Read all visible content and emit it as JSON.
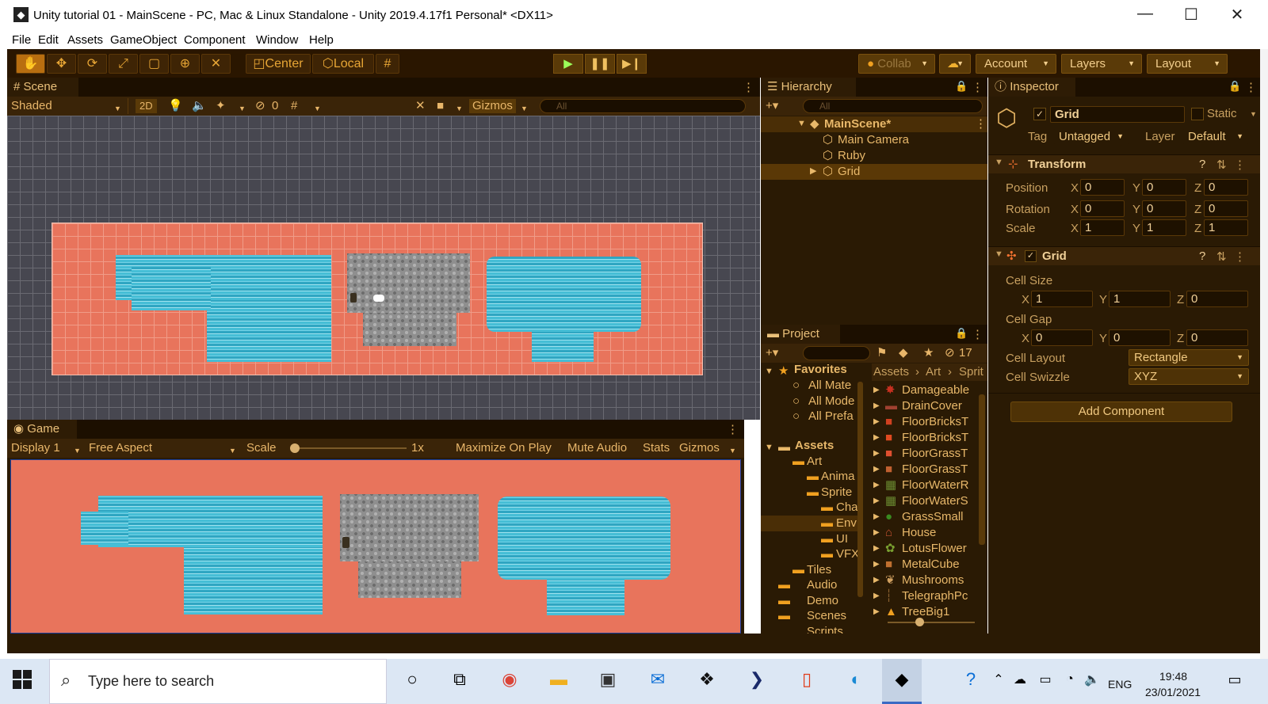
{
  "window": {
    "title": "Unity tutorial 01 - MainScene - PC, Mac & Linux Standalone - Unity 2019.4.17f1 Personal* <DX11>",
    "minimize": "—",
    "maximize": "☐",
    "close": "✕"
  },
  "menu": [
    "File",
    "Edit",
    "Assets",
    "GameObject",
    "Component",
    "Window",
    "Help"
  ],
  "toolbar": {
    "center": "Center",
    "local": "Local",
    "collab": "Collab",
    "account": "Account",
    "layers": "Layers",
    "layout": "Layout"
  },
  "scene": {
    "tab": "Scene",
    "shading": "Shaded",
    "mode2d": "2D",
    "hidden_count": "0",
    "gizmos": "Gizmos",
    "search_placeholder": "All"
  },
  "game": {
    "tab": "Game",
    "display": "Display 1",
    "aspect": "Free Aspect",
    "scale_label": "Scale",
    "scale_value": "1x",
    "scale_slider": 0.0,
    "maximize": "Maximize On Play",
    "mute": "Mute Audio",
    "stats": "Stats",
    "gizmos": "Gizmos"
  },
  "hierarchy": {
    "tab": "Hierarchy",
    "search_placeholder": "All",
    "scene": "MainScene*",
    "items": [
      "Main Camera",
      "Ruby",
      "Grid"
    ]
  },
  "project": {
    "tab": "Project",
    "badge": "17",
    "favorites": "Favorites",
    "fav_items": [
      "All Mate",
      "All Mode",
      "All Prefa"
    ],
    "assets": "Assets",
    "tree": [
      "Art",
      "Anima",
      "Sprite",
      "Cha",
      "Env",
      "UI",
      "VFX",
      "Tiles",
      "Audio",
      "Demo",
      "Scenes",
      "Scripts"
    ],
    "breadcrumb": [
      "Assets",
      "Art",
      "Sprit"
    ],
    "files": [
      "Damageable",
      "DrainCover",
      "FloorBricksT",
      "FloorBricksT",
      "FloorGrassT",
      "FloorGrassT",
      "FloorWaterR",
      "FloorWaterS",
      "GrassSmall",
      "House",
      "LotusFlower",
      "MetalCube",
      "Mushrooms",
      "TelegraphPc",
      "TreeBig1"
    ]
  },
  "inspector": {
    "tab": "Inspector",
    "name": "Grid",
    "static": "Static",
    "tag_label": "Tag",
    "tag": "Untagged",
    "layer_label": "Layer",
    "layer": "Default",
    "transform": {
      "title": "Transform",
      "position": "Position",
      "rotation": "Rotation",
      "scale": "Scale",
      "x": "X",
      "y": "Y",
      "z": "Z",
      "pos": [
        "0",
        "0",
        "0"
      ],
      "rot": [
        "0",
        "0",
        "0"
      ],
      "scl": [
        "1",
        "1",
        "1"
      ]
    },
    "grid": {
      "title": "Grid",
      "cell_size": "Cell Size",
      "cs": [
        "1",
        "1",
        "0"
      ],
      "cell_gap": "Cell Gap",
      "cg": [
        "0",
        "0",
        "0"
      ],
      "cell_layout": "Cell Layout",
      "layout_value": "Rectangle",
      "cell_swizzle": "Cell Swizzle",
      "swizzle_value": "XYZ"
    },
    "add_component": "Add Component"
  },
  "taskbar": {
    "search": "Type here to search",
    "lang": "ENG",
    "time": "19:48",
    "date": "23/01/2021"
  },
  "colors": {
    "editor_bg": "#2a1a04",
    "accent": "#e8a635",
    "ground": "#e8745c"
  }
}
